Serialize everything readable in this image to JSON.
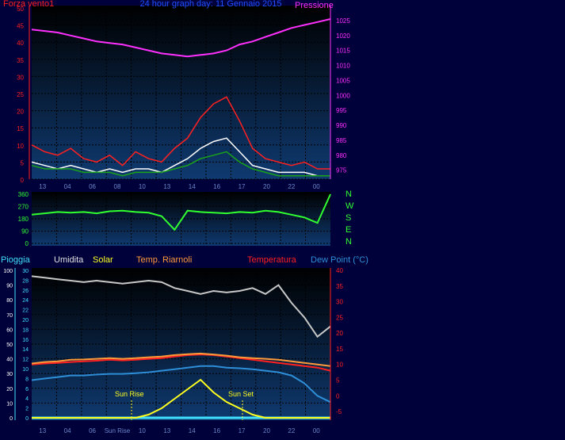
{
  "header": {
    "left_label": "Forza vento1",
    "title": "24 hour graph day: 11 Gennaio 2015",
    "right_label": "Pressione"
  },
  "colors": {
    "background": "#00003a",
    "plot_bg_top": "#000000",
    "plot_bg_bottom": "#0f3a70",
    "wind_gust": "#ff2020",
    "wind_avg": "#ffffff",
    "wind_green": "#1aa31a",
    "pressure": "#ff30ff",
    "direction": "#30ff30",
    "humidity": "#c8c8c8",
    "temperature": "#ff2020",
    "roof_temp": "#ff9a3a",
    "dew_point": "#2e8fd8",
    "solar": "#ffff20",
    "rain": "#40e0ff",
    "grid": "#000000"
  },
  "chart_data": [
    {
      "type": "line",
      "name": "wind-pressure",
      "x_ticks": [
        "13",
        "04",
        "06",
        "08",
        "10",
        "13",
        "14",
        "16",
        "17",
        "20",
        "22",
        "00"
      ],
      "left_axis": {
        "label": "Forza vento1",
        "min": 0,
        "max": 50,
        "ticks": [
          0,
          5,
          10,
          15,
          20,
          25,
          30,
          35,
          40,
          45,
          50
        ]
      },
      "right_axis": {
        "label": "Pressione",
        "min": 972,
        "max": 1030,
        "ticks": [
          975,
          980,
          985,
          990,
          995,
          1000,
          1005,
          1010,
          1015,
          1020,
          1025
        ]
      },
      "series": [
        {
          "name": "Pressione",
          "axis": "right",
          "values": [
            1022,
            1021.5,
            1021,
            1020,
            1019,
            1018,
            1017.5,
            1017,
            1016,
            1015,
            1014,
            1013.5,
            1013,
            1013.5,
            1014,
            1015,
            1017,
            1018,
            1019.5,
            1021,
            1022.5,
            1023.5,
            1024.5,
            1025.5
          ]
        },
        {
          "axis": "left",
          "values": [
            10,
            8,
            7,
            9,
            6,
            5,
            7,
            4,
            8,
            6,
            5,
            9,
            12,
            18,
            22,
            24,
            17,
            9,
            6,
            5,
            4,
            5,
            3,
            3
          ]
        },
        {
          "axis": "left",
          "values": [
            5,
            4,
            3,
            4,
            3,
            2,
            3,
            2,
            3,
            3,
            2,
            4,
            6,
            9,
            11,
            12,
            8,
            4,
            3,
            2,
            2,
            2,
            1,
            1
          ]
        },
        {
          "axis": "left",
          "values": [
            4,
            3,
            3,
            3,
            2,
            2,
            2,
            1,
            2,
            2,
            2,
            3,
            4,
            6,
            7,
            8,
            5,
            3,
            2,
            1,
            1,
            1,
            1,
            1
          ]
        }
      ],
      "grid": true
    },
    {
      "type": "line",
      "name": "wind-direction",
      "y_axis": {
        "min": 0,
        "max": 360,
        "ticks": [
          0,
          90,
          180,
          270,
          360
        ]
      },
      "compass_labels": [
        "N",
        "W",
        "S",
        "E",
        "N"
      ],
      "series": [
        {
          "values": [
            210,
            220,
            230,
            225,
            230,
            220,
            235,
            240,
            230,
            225,
            200,
            100,
            240,
            230,
            225,
            220,
            230,
            225,
            240,
            230,
            210,
            190,
            150,
            360
          ]
        }
      ],
      "grid": true
    },
    {
      "type": "line",
      "name": "humidity-temperature",
      "x_ticks": [
        "13",
        "04",
        "06",
        "Sun Rise",
        "10",
        "13",
        "14",
        "16",
        "17",
        "20",
        "22",
        "00"
      ],
      "header_labels": [
        "Pioggia",
        "Umidita",
        "Solar",
        "Temp. Riarnoli",
        "Temperatura",
        "Dew Point (°C)"
      ],
      "left_axis_rain": {
        "min": 0,
        "max": 100,
        "ticks": [
          0,
          10,
          20,
          30,
          40,
          50,
          60,
          70,
          80,
          90,
          100
        ]
      },
      "left_axis_humidity": {
        "ticks": [
          0,
          2,
          4,
          6,
          8,
          10,
          12,
          14,
          16,
          18,
          20,
          22,
          24,
          26,
          28,
          30
        ]
      },
      "right_axis_temp": {
        "min": -7,
        "max": 40,
        "ticks": [
          -5,
          0,
          5,
          10,
          15,
          20,
          25,
          30,
          35,
          40
        ]
      },
      "annotations": [
        "Sun Rise",
        "Sun Set"
      ],
      "series": [
        {
          "axis": "right",
          "values": [
            10,
            10.3,
            10.5,
            10.8,
            11,
            11.2,
            11.5,
            11.3,
            11.5,
            11.8,
            12,
            12.5,
            13,
            13.2,
            13,
            12.5,
            12,
            11.5,
            11,
            10.5,
            10,
            9.5,
            9,
            8
          ]
        },
        {
          "axis": "right",
          "values": [
            10.3,
            10.8,
            11,
            11.5,
            11.6,
            11.8,
            12,
            11.8,
            12,
            12.3,
            12.5,
            13,
            13.3,
            13.5,
            13.2,
            12.8,
            12.3,
            12,
            11.8,
            11.5,
            11,
            10.5,
            10,
            9.5
          ]
        },
        {
          "axis": "right",
          "values": [
            5,
            5.5,
            6,
            6.5,
            6.5,
            6.8,
            7,
            7,
            7.2,
            7.5,
            8,
            8.5,
            9,
            9.5,
            9.5,
            9,
            8.8,
            8.5,
            8,
            7.5,
            6.5,
            4,
            0,
            -2
          ]
        },
        {
          "axis": "humidity",
          "values": [
            96,
            95,
            94,
            93,
            92,
            93,
            92,
            91,
            92,
            93,
            92,
            88,
            86,
            84,
            86,
            85,
            86,
            88,
            84,
            90,
            78,
            68,
            55,
            62
          ]
        },
        {
          "axis": "rain",
          "values": [
            0,
            0,
            0,
            0,
            0,
            0,
            0,
            0,
            0,
            0,
            0,
            0,
            0,
            0,
            0,
            0,
            0,
            0,
            0,
            0,
            0,
            0,
            0,
            0
          ]
        },
        {
          "axis": "solar",
          "values": [
            0,
            0,
            0,
            0,
            0,
            0,
            0,
            0,
            0,
            1,
            3,
            6,
            9,
            12,
            8,
            5,
            3,
            1,
            0,
            0,
            0,
            0,
            0,
            0
          ]
        }
      ],
      "grid": true
    }
  ]
}
